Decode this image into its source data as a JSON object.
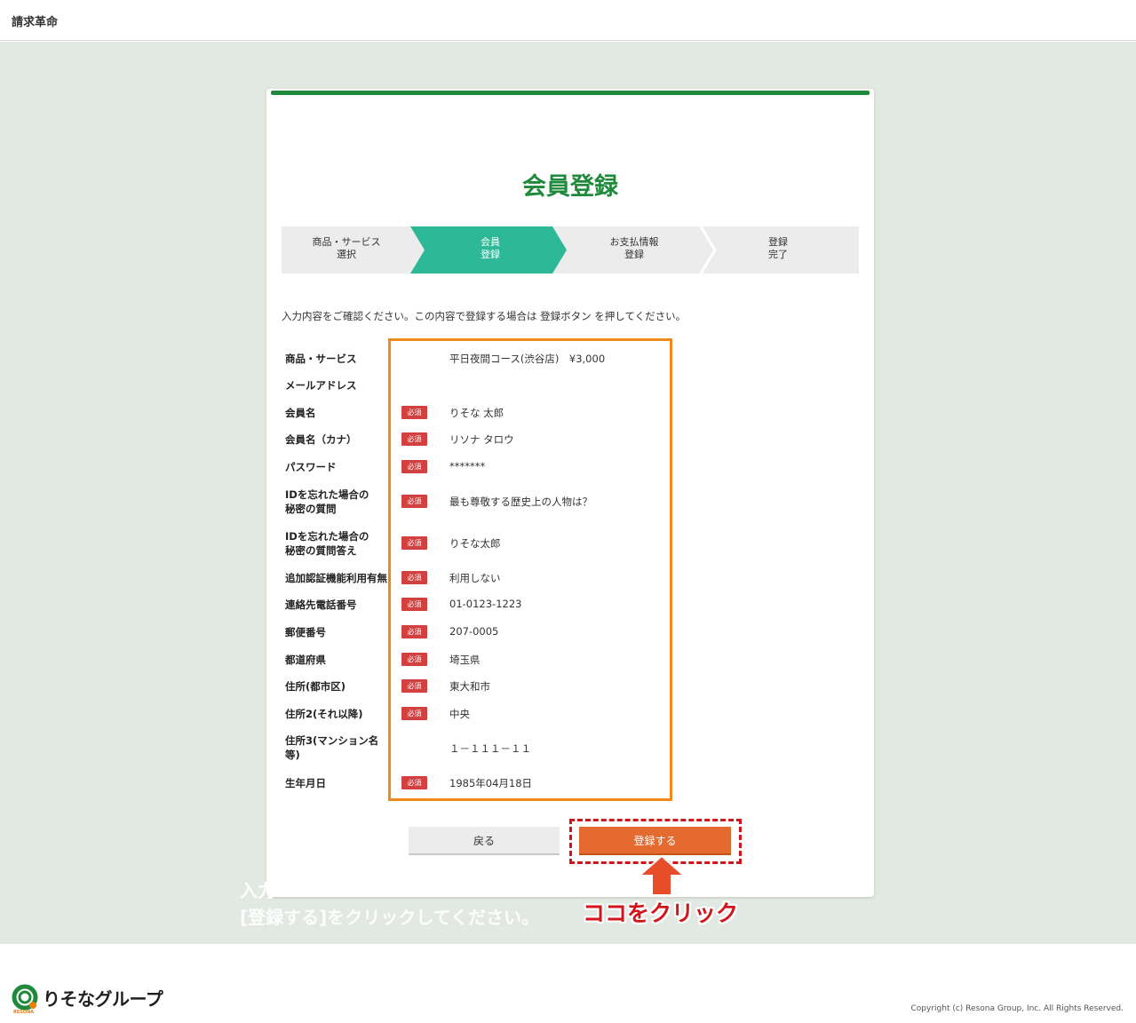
{
  "header": {
    "app_title": "請求革命"
  },
  "card": {
    "title": "会員登録"
  },
  "steps": [
    {
      "line1": "商品・サービス",
      "line2": "選択"
    },
    {
      "line1": "会員",
      "line2": "登録"
    },
    {
      "line1": "お支払情報",
      "line2": "登録"
    },
    {
      "line1": "登録",
      "line2": "完了"
    }
  ],
  "instruction": "入力内容をご確認ください。この内容で登録する場合は 登録ボタン を押してください。",
  "required_badge": "必須",
  "form": [
    {
      "label": "商品・サービス",
      "required": false,
      "value": "平日夜間コース(渋谷店)　¥3,000"
    },
    {
      "label": "メールアドレス",
      "required": false,
      "value": ""
    },
    {
      "label": "会員名",
      "required": true,
      "value": "りそな 太郎"
    },
    {
      "label": "会員名（カナ）",
      "required": true,
      "value": "リソナ タロウ"
    },
    {
      "label": "パスワード",
      "required": true,
      "value": "*******"
    },
    {
      "label": "IDを忘れた場合の",
      "label2": "秘密の質問",
      "required": true,
      "value": "最も尊敬する歴史上の人物は？"
    },
    {
      "label": "IDを忘れた場合の",
      "label2": "秘密の質問答え",
      "required": true,
      "value": "りそな太郎"
    },
    {
      "label": "追加認証機能利用有無",
      "required": true,
      "value": "利用しない"
    },
    {
      "label": "連絡先電話番号",
      "required": true,
      "value": "01-0123-1223"
    },
    {
      "label": "郵便番号",
      "required": true,
      "value": "207-0005"
    },
    {
      "label": "都道府県",
      "required": true,
      "value": "埼玉県"
    },
    {
      "label": "住所(都市区)",
      "required": true,
      "value": "東大和市"
    },
    {
      "label": "住所2(それ以降)",
      "required": true,
      "value": "中央"
    },
    {
      "label": "住所3(マンション名",
      "label2": "等)",
      "required": false,
      "value": "１－１１１－１１"
    },
    {
      "label": "生年月日",
      "required": true,
      "value": "1985年04月18日"
    }
  ],
  "buttons": {
    "back": "戻る",
    "register": "登録する"
  },
  "annotation": {
    "click_here": "ココをクリック",
    "overlay_line1": "入力",
    "overlay_line2": "[登録する]をクリックしてください。"
  },
  "footer": {
    "logo_text": "りそなグループ",
    "logo_sub": "RESONA",
    "copyright": "Copyright (c) Resona Group, Inc. All Rights Reserved."
  },
  "colors": {
    "brand_green": "#1f8a3c",
    "step_active": "#2db898",
    "badge_red": "#d24040",
    "button_orange": "#e56a2f",
    "highlight_orange": "#ee8a1c",
    "annotation_red": "#d0161b"
  }
}
